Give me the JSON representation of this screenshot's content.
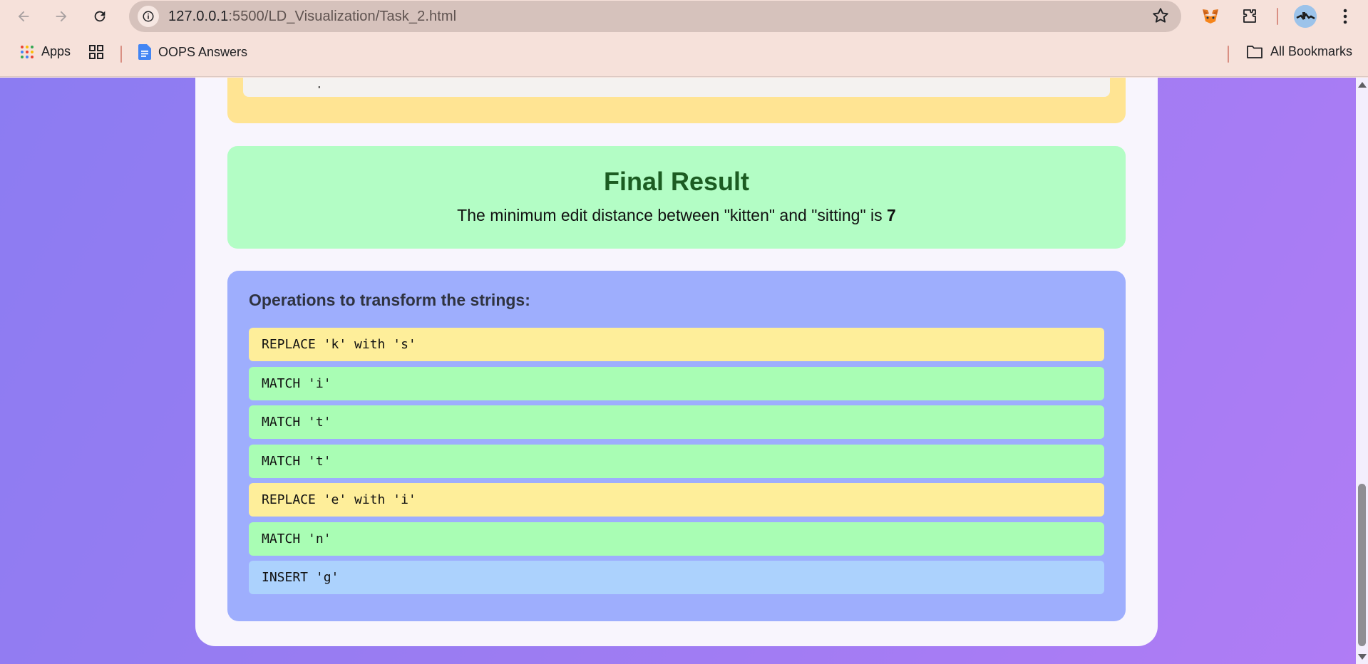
{
  "browser": {
    "url_host": "127.0.0.1",
    "url_rest": ":5500/LD_Visualization/Task_2.html",
    "icons": [
      "back-arrow-icon",
      "forward-arrow-icon",
      "reload-icon",
      "site-info-icon",
      "star-icon",
      "metamask-fox-icon",
      "extensions-puzzle-icon",
      "profile-avatar-icon",
      "more-vert-icon"
    ]
  },
  "bookmarks": {
    "apps_label": "Apps",
    "oops_label": "OOPS Answers",
    "all_label": "All Bookmarks"
  },
  "page": {
    "prev_fragment": "·",
    "final_result": {
      "title": "Final Result",
      "text_prefix": "The minimum edit distance between \"kitten\" and \"sitting\" is ",
      "distance": "7"
    },
    "operations": {
      "heading": "Operations to transform the strings:",
      "items": [
        {
          "text": "REPLACE 'k' with 's'",
          "kind": "replace"
        },
        {
          "text": "MATCH 'i'",
          "kind": "match"
        },
        {
          "text": "MATCH 't'",
          "kind": "match"
        },
        {
          "text": "MATCH 't'",
          "kind": "match"
        },
        {
          "text": "REPLACE 'e' with 'i'",
          "kind": "replace"
        },
        {
          "text": "MATCH 'n'",
          "kind": "match"
        },
        {
          "text": "INSERT 'g'",
          "kind": "insert"
        }
      ]
    }
  },
  "colors": {
    "replace": "#feee9a",
    "match": "#a9fdb4",
    "insert": "#acd2fd",
    "result_bg": "#b3fdc5",
    "ops_bg": "#9eaefd"
  }
}
